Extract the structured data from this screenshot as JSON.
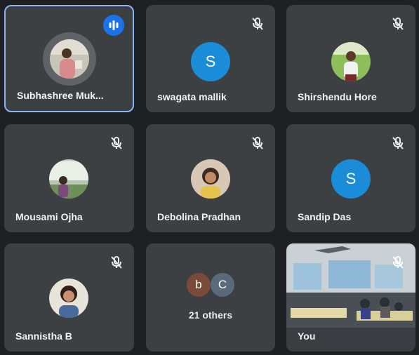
{
  "participants": [
    {
      "name": "Subhashree Muk...",
      "status": "speaking"
    },
    {
      "name": "swagata mallik",
      "initial": "S",
      "status": "muted"
    },
    {
      "name": "Shirshendu Hore",
      "status": "muted"
    },
    {
      "name": "Mousami Ojha",
      "status": "muted"
    },
    {
      "name": "Debolina Pradhan",
      "status": "muted"
    },
    {
      "name": "Sandip Das",
      "initial": "S",
      "status": "muted"
    },
    {
      "name": "Sannistha B",
      "status": "muted"
    }
  ],
  "others": {
    "initials": [
      "b",
      "C"
    ],
    "label": "21 others"
  },
  "self": {
    "name": "You",
    "status": "muted"
  },
  "colors": {
    "tile": "#3c4043",
    "background": "#1f2023",
    "speaking_border": "#8ab4f8",
    "speaking_badge": "#1a73e8",
    "letter_avatar": "#1a8cd8"
  }
}
